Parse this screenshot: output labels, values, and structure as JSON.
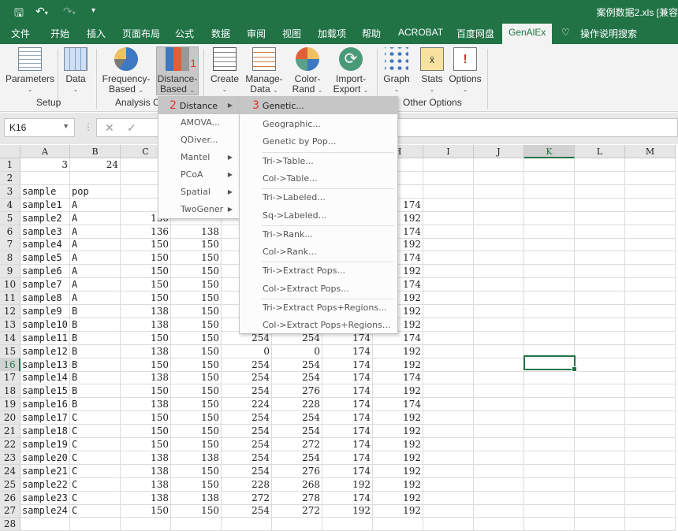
{
  "titlebar": {
    "document_title": "案例数据2.xls  [兼容",
    "save_icon": "save-icon",
    "undo_icon": "undo-icon",
    "redo_icon": "redo-icon",
    "customize": "▾"
  },
  "tabs": [
    "文件",
    "开始",
    "插入",
    "页面布局",
    "公式",
    "数据",
    "审阅",
    "视图",
    "加载项",
    "帮助",
    "ACROBAT",
    "百度网盘",
    "GenAlEx",
    "操作说明搜索"
  ],
  "active_tab": "GenAlEx",
  "ribbon": {
    "buttons": [
      {
        "l1": "Parameters",
        "l2": ""
      },
      {
        "l1": "Data",
        "l2": ""
      },
      {
        "l1": "Frequency-",
        "l2": "Based"
      },
      {
        "l1": "Distance-",
        "l2": "Based"
      },
      {
        "l1": "Create",
        "l2": ""
      },
      {
        "l1": "Manage-",
        "l2": "Data"
      },
      {
        "l1": "Color-",
        "l2": "Rand"
      },
      {
        "l1": "Import-",
        "l2": "Export"
      },
      {
        "l1": "Graph",
        "l2": ""
      },
      {
        "l1": "Stats",
        "l2": ""
      },
      {
        "l1": "Options",
        "l2": ""
      }
    ],
    "groups": [
      "Setup",
      "Analysis C",
      "Other Options"
    ],
    "annotation": "1"
  },
  "formula_bar": {
    "name_box": "K16",
    "cancel": "✕",
    "enter": "✓",
    "fx": "fx"
  },
  "columns": [
    "A",
    "B",
    "C",
    "D",
    "E",
    "F",
    "G",
    "H",
    "I",
    "J",
    "K",
    "L",
    "M"
  ],
  "selected_cell": "K16",
  "rows": [
    [
      "3",
      "24",
      "",
      "",
      "",
      "",
      "",
      "",
      "",
      "",
      "",
      "",
      ""
    ],
    [
      "",
      "",
      "",
      "",
      "",
      "",
      "",
      "",
      "",
      "",
      "",
      "",
      ""
    ],
    [
      "sample",
      "pop",
      "",
      "",
      "",
      "",
      "",
      "",
      "",
      "",
      "",
      "",
      ""
    ],
    [
      "sample1",
      "A",
      "1",
      "",
      "",
      "",
      "",
      "174",
      "",
      "",
      "",
      "",
      ""
    ],
    [
      "sample2",
      "A",
      "150",
      "",
      "",
      "",
      "",
      "192",
      "",
      "",
      "",
      "",
      ""
    ],
    [
      "sample3",
      "A",
      "136",
      "138",
      "",
      "",
      "",
      "174",
      "",
      "",
      "",
      "",
      ""
    ],
    [
      "sample4",
      "A",
      "150",
      "150",
      "",
      "",
      "",
      "192",
      "",
      "",
      "",
      "",
      ""
    ],
    [
      "sample5",
      "A",
      "150",
      "150",
      "",
      "",
      "",
      "174",
      "",
      "",
      "",
      "",
      ""
    ],
    [
      "sample6",
      "A",
      "150",
      "150",
      "",
      "",
      "",
      "192",
      "",
      "",
      "",
      "",
      ""
    ],
    [
      "sample7",
      "A",
      "150",
      "150",
      "",
      "",
      "",
      "174",
      "",
      "",
      "",
      "",
      ""
    ],
    [
      "sample8",
      "A",
      "150",
      "150",
      "",
      "",
      "",
      "192",
      "",
      "",
      "",
      "",
      ""
    ],
    [
      "sample9",
      "B",
      "138",
      "150",
      "",
      "",
      "",
      "192",
      "",
      "",
      "",
      "",
      ""
    ],
    [
      "sample10",
      "B",
      "138",
      "150",
      "",
      "",
      "",
      "192",
      "",
      "",
      "",
      "",
      ""
    ],
    [
      "sample11",
      "B",
      "150",
      "150",
      "254",
      "254",
      "174",
      "174",
      "",
      "",
      "",
      "",
      ""
    ],
    [
      "sample12",
      "B",
      "138",
      "150",
      "0",
      "0",
      "174",
      "192",
      "",
      "",
      "",
      "",
      ""
    ],
    [
      "sample13",
      "B",
      "150",
      "150",
      "254",
      "254",
      "174",
      "192",
      "",
      "",
      "",
      "",
      ""
    ],
    [
      "sample14",
      "B",
      "138",
      "150",
      "254",
      "254",
      "174",
      "174",
      "",
      "",
      "",
      "",
      ""
    ],
    [
      "sample15",
      "B",
      "150",
      "150",
      "254",
      "276",
      "174",
      "192",
      "",
      "",
      "",
      "",
      ""
    ],
    [
      "sample16",
      "B",
      "138",
      "150",
      "224",
      "228",
      "174",
      "174",
      "",
      "",
      "",
      "",
      ""
    ],
    [
      "sample17",
      "C",
      "150",
      "150",
      "254",
      "254",
      "174",
      "192",
      "",
      "",
      "",
      "",
      ""
    ],
    [
      "sample18",
      "C",
      "150",
      "150",
      "254",
      "254",
      "174",
      "192",
      "",
      "",
      "",
      "",
      ""
    ],
    [
      "sample19",
      "C",
      "150",
      "150",
      "254",
      "272",
      "174",
      "192",
      "",
      "",
      "",
      "",
      ""
    ],
    [
      "sample20",
      "C",
      "138",
      "138",
      "254",
      "254",
      "174",
      "192",
      "",
      "",
      "",
      "",
      ""
    ],
    [
      "sample21",
      "C",
      "138",
      "150",
      "254",
      "276",
      "174",
      "192",
      "",
      "",
      "",
      "",
      ""
    ],
    [
      "sample22",
      "C",
      "138",
      "150",
      "228",
      "268",
      "192",
      "192",
      "",
      "",
      "",
      "",
      ""
    ],
    [
      "sample23",
      "C",
      "138",
      "138",
      "272",
      "278",
      "174",
      "192",
      "",
      "",
      "",
      "",
      ""
    ],
    [
      "sample24",
      "C",
      "150",
      "150",
      "254",
      "272",
      "192",
      "192",
      "",
      "",
      "",
      "",
      ""
    ],
    [
      "",
      "",
      "",
      "",
      "",
      "",
      "",
      "",
      "",
      "",
      "",
      "",
      ""
    ]
  ],
  "menu": {
    "annotation": "2",
    "items": [
      {
        "label": "Distance",
        "sub": true
      },
      {
        "label": "AMOVA...",
        "sub": false
      },
      {
        "label": "QDiver...",
        "sub": false
      },
      {
        "label": "Mantel",
        "sub": true
      },
      {
        "label": "PCoA",
        "sub": true
      },
      {
        "label": "Spatial",
        "sub": true
      },
      {
        "label": "TwoGener",
        "sub": true
      }
    ]
  },
  "submenu": {
    "annotation": "3",
    "items": [
      "Genetic...",
      "Geographic...",
      "Genetic by Pop...",
      "Tri->Table...",
      "Col->Table...",
      "Tri->Labeled...",
      "Sq->Labeled...",
      "Tri->Rank...",
      "Col->Rank...",
      "Tri->Extract Pops...",
      "Col->Extract Pops...",
      "Tri->Extract Pops+Regions...",
      "Col->Extract Pops+Regions..."
    ]
  },
  "colors": {
    "accent": "#217346",
    "highlight": "#c6c6c6",
    "annotation": "#e03030"
  }
}
